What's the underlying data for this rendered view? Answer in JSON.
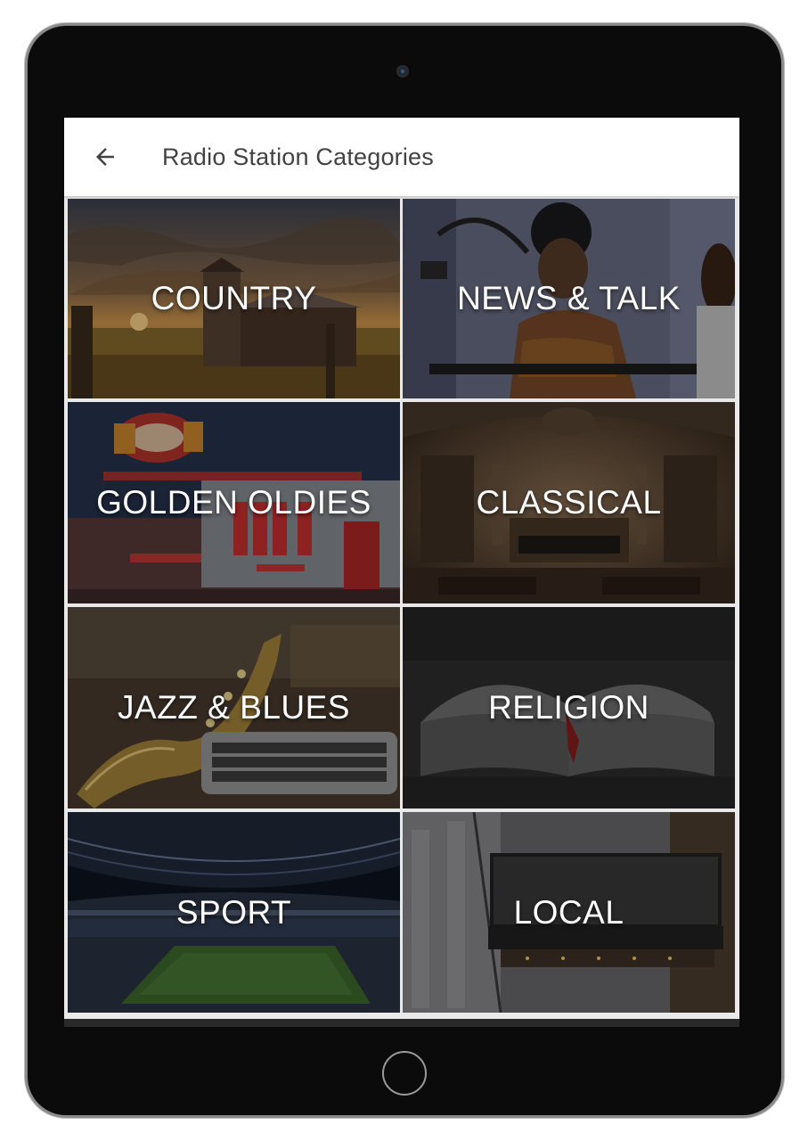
{
  "app_bar": {
    "back_icon": "arrow-back-icon",
    "title": "Radio Station Categories"
  },
  "categories": [
    {
      "label": "COUNTRY",
      "image": "farm-barn-sunset"
    },
    {
      "label": "NEWS & TALK",
      "image": "radio-host-microphone"
    },
    {
      "label": "GOLDEN OLDIES",
      "image": "retro-diner"
    },
    {
      "label": "CLASSICAL",
      "image": "concert-hall-orchestra"
    },
    {
      "label": "JAZZ & BLUES",
      "image": "saxophone-typewriter"
    },
    {
      "label": "RELIGION",
      "image": "open-book"
    },
    {
      "label": "SPORT",
      "image": "stadium"
    },
    {
      "label": "LOCAL",
      "image": "local-marquee-sign"
    }
  ],
  "theme": {
    "app_bar_bg": "#ffffff",
    "title_color": "#424242",
    "tile_text": "#ffffff"
  }
}
